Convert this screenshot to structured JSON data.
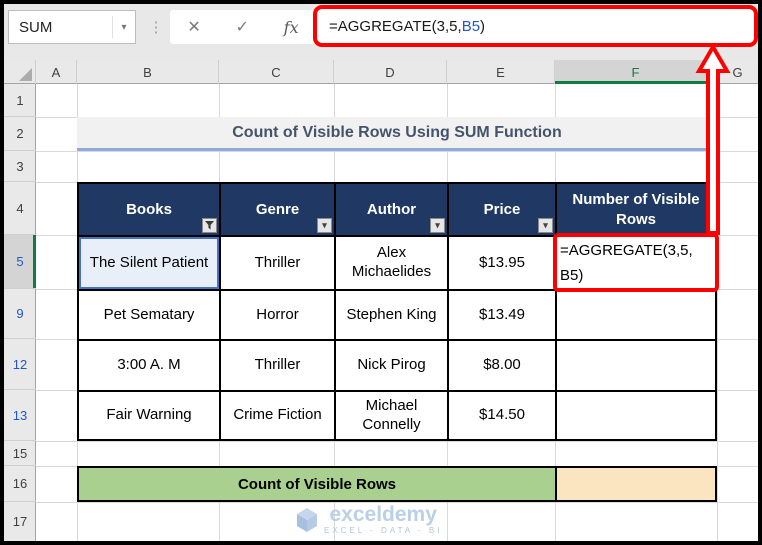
{
  "topbar": {
    "name_box_value": "SUM",
    "icons": {
      "name_box_dropdown": "▾",
      "menu_dots": "⋮",
      "cancel": "✕",
      "enter": "✓",
      "insert_function": "fx",
      "filter_dropdown": "▾"
    },
    "formula": {
      "prefix": "=AGGREGATE(3,5,",
      "ref": "B5",
      "suffix": ")"
    }
  },
  "grid": {
    "columns": [
      "A",
      "B",
      "C",
      "D",
      "E",
      "F",
      "G"
    ],
    "rows": [
      "1",
      "2",
      "3",
      "4",
      "5",
      "9",
      "12",
      "13",
      "15",
      "16",
      "17"
    ],
    "selected_column": "F",
    "selected_row": "5",
    "filtered_blue_rows": [
      "5",
      "9",
      "12",
      "13"
    ]
  },
  "sheet": {
    "title": "Count of Visible Rows Using SUM Function",
    "table": {
      "headers": [
        "Books",
        "Genre",
        "Author",
        "Price",
        "Number of Visible Rows"
      ],
      "rows": [
        {
          "book": "The Silent Patient",
          "genre": "Thriller",
          "author": "Alex Michaelides",
          "price": "$13.95"
        },
        {
          "book": "Pet Sematary",
          "genre": "Horror",
          "author": "Stephen King",
          "price": "$13.49"
        },
        {
          "book": "3:00 A. M",
          "genre": "Thriller",
          "author": "Nick Pirog",
          "price": "$8.00"
        },
        {
          "book": "Fair Warning",
          "genre": "Crime Fiction",
          "author": "Michael Connelly",
          "price": "$14.50"
        }
      ],
      "f5_cell": {
        "line1": "=AGGREGATE(3,5,",
        "line2": "B5)"
      }
    },
    "footer_label": "Count of Visible Rows",
    "footer_result_cell": ""
  },
  "watermark": {
    "brand": "exceldemy",
    "tagline": "EXCEL - DATA - BI"
  },
  "colors": {
    "table_header_navy": "#1F3864",
    "title_text": "#44546A",
    "title_underline": "#8FAADC",
    "annotation_red": "#FE0000",
    "selected_green": "#107C41",
    "filtered_row_blue": "#2456C4",
    "reference_cell_blue": "#4472C4",
    "footer_green": "#A9D08E",
    "footer_cream": "#FBE5C0"
  }
}
